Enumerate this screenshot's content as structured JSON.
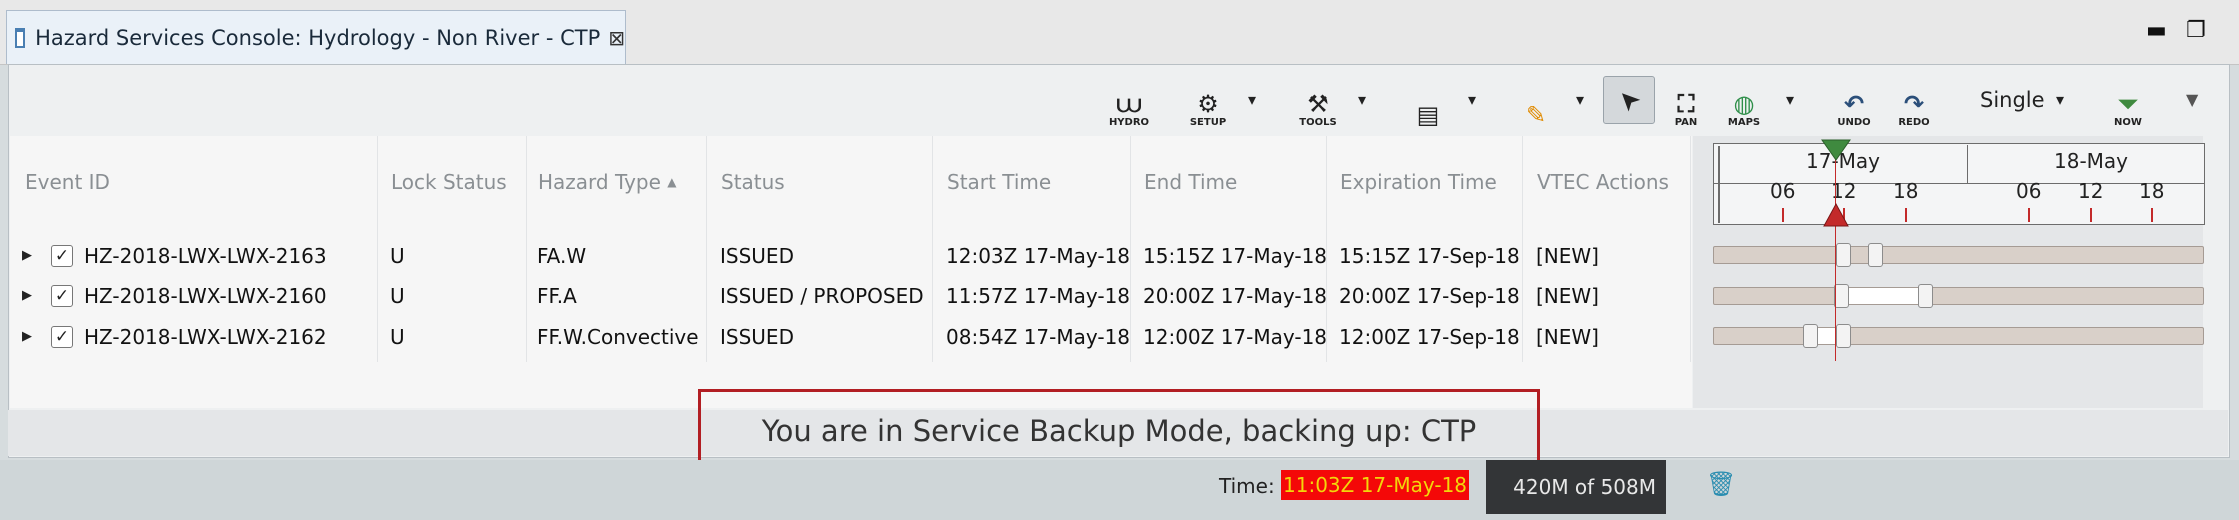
{
  "tab": {
    "title": "Hazard Services Console: Hydrology - Non River - CTP",
    "close_glyph": "⊠"
  },
  "window_controls": {
    "minimize": "▬",
    "maximize": "❐"
  },
  "toolbar": {
    "hydro": {
      "label": "HYDRO",
      "icon": "hydro-icon",
      "glyph": "⩊"
    },
    "setup": {
      "label": "SETUP",
      "icon": "gear-icon",
      "glyph": "⚙"
    },
    "tools": {
      "label": "TOOLS",
      "icon": "hammer-icon",
      "glyph": "⚒"
    },
    "document": {
      "icon": "document-icon",
      "glyph": "▤"
    },
    "draw": {
      "icon": "pencil-icon",
      "glyph": "✎"
    },
    "select": {
      "icon": "arrow-cursor-icon",
      "glyph": "➤"
    },
    "pan": {
      "label": "PAN",
      "icon": "pan-icon",
      "glyph": "⛶"
    },
    "maps": {
      "label": "MAPS",
      "icon": "globe-icon",
      "glyph": "◍"
    },
    "undo": {
      "label": "UNDO",
      "icon": "undo-icon",
      "glyph": "↶"
    },
    "redo": {
      "label": "REDO",
      "icon": "redo-icon",
      "glyph": "↷"
    },
    "mode": {
      "selected": "Single"
    },
    "now": {
      "label": "NOW",
      "icon": "now-icon",
      "glyph": "⏷"
    },
    "caret_glyph": "▾",
    "menu_glyph": "▼"
  },
  "table": {
    "columns": [
      "Event ID",
      "Lock Status",
      "Hazard Type",
      "Status",
      "Start Time",
      "End Time",
      "Expiration Time",
      "VTEC Actions"
    ],
    "sort_glyph": "▲",
    "expander_glyph": "▶",
    "check_glyph": "✓",
    "rows": [
      {
        "event_id": "HZ-2018-LWX-LWX-2163",
        "lock": "U",
        "hazard": "FA.W",
        "status": "ISSUED",
        "start": "12:03Z 17-May-18",
        "end": "15:15Z 17-May-18",
        "expiration": "15:15Z 17-Sep-18",
        "vtec": "[NEW]",
        "checked": true
      },
      {
        "event_id": "HZ-2018-LWX-LWX-2160",
        "lock": "U",
        "hazard": "FF.A",
        "status": "ISSUED / PROPOSED",
        "start": "11:57Z 17-May-18",
        "end": "20:00Z 17-May-18",
        "expiration": "20:00Z 17-Sep-18",
        "vtec": "[NEW]",
        "checked": true
      },
      {
        "event_id": "HZ-2018-LWX-LWX-2162",
        "lock": "U",
        "hazard": "FF.W.Convective",
        "status": "ISSUED",
        "start": "08:54Z 17-May-18",
        "end": "12:00Z 17-May-18",
        "expiration": "12:00Z 17-Sep-18",
        "vtec": "[NEW]",
        "checked": true
      }
    ]
  },
  "timeline": {
    "days": [
      "17-May",
      "18-May"
    ],
    "ticks": [
      "06",
      "12",
      "18",
      "06",
      "12",
      "18"
    ],
    "colors": {
      "current_marker": "#c32a2a",
      "now_marker": "#3f8a3f",
      "bar": "#d9d0c9",
      "span": "#ffffff"
    }
  },
  "banner": {
    "text": "You are in Service Backup Mode, backing up: CTP",
    "border_color": "#b21e23"
  },
  "status_bar": {
    "time_label": "Time:",
    "time_value": "11:03Z 17-May-18",
    "time_bg": "#f40808",
    "time_fg": "#f2d70a",
    "memory": "420M of 508M",
    "trash_glyph": "🗑"
  }
}
